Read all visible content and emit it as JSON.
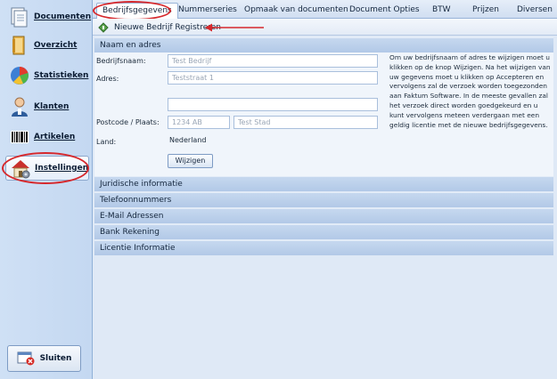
{
  "sidebar": {
    "items": [
      {
        "label": "Documenten",
        "icon": "documents-icon"
      },
      {
        "label": "Overzicht",
        "icon": "overview-icon"
      },
      {
        "label": "Statistieken",
        "icon": "pie-chart-icon"
      },
      {
        "label": "Klanten",
        "icon": "customer-icon"
      },
      {
        "label": "Artikelen",
        "icon": "barcode-icon"
      },
      {
        "label": "Instellingen",
        "icon": "settings-house-icon"
      }
    ],
    "active": "Instellingen",
    "close_label": "Sluiten"
  },
  "tabs": {
    "items": [
      "Bedrijfsgegevens",
      "Nummerseries",
      "Opmaak van documenten",
      "Document Opties",
      "BTW",
      "Prijzen",
      "Diversen"
    ],
    "active": "Bedrijfsgegevens"
  },
  "toolbar": {
    "register_label": "Nieuwe Bedrijf Registreren"
  },
  "sections": {
    "naam_adres": "Naam en adres",
    "collapsed": [
      "Juridische informatie",
      "Telefoonnummers",
      "E-Mail Adressen",
      "Bank Rekening",
      "Licentie Informatie"
    ]
  },
  "form": {
    "company_label": "Bedrijfsnaam:",
    "company_value": "Test Bedrijf",
    "address_label": "Adres:",
    "address_value": "Teststraat 1",
    "address2_value": "",
    "postcode_label": "Postcode / Plaats:",
    "postcode_value": "1234 AB",
    "city_value": "Test Stad",
    "country_label": "Land:",
    "country_value": "Nederland",
    "change_button": "Wijzigen"
  },
  "info": "Om uw bedrijfsnaam of adres te wijzigen moet u klikken op de knop Wijzigen. Na het wijzigen van uw gegevens moet u klikken op Accepteren en vervolgens zal de verzoek  worden toegezonden aan Faktum Software. In de meeste gevallen zal het verzoek direct worden goedgekeurd  en u kunt vervolgens meteen verdergaan met een geldig licentie met de nieuwe bedrijfsgegevens.",
  "colors": {
    "annotation": "#d6282c",
    "section_header": "#b2c9e7",
    "sidebar": "#c4d8f1"
  }
}
